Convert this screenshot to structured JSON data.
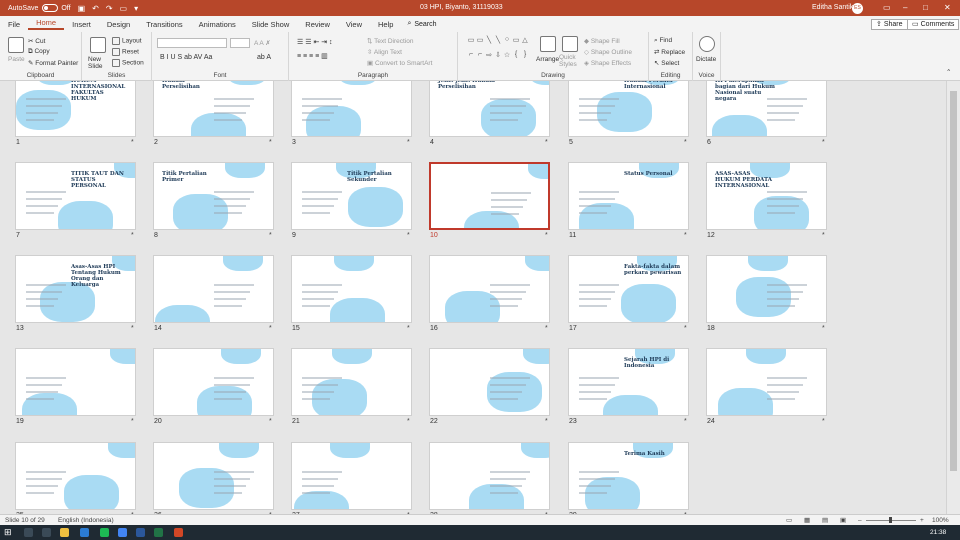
{
  "titlebar": {
    "autosave_label": "AutoSave",
    "autosave_state": "Off",
    "doc_title": "03 HPI, Biyanto, 31119033",
    "user_name": "Editha Santika",
    "user_initials": "ES"
  },
  "tabs": [
    "File",
    "Home",
    "Insert",
    "Design",
    "Transitions",
    "Animations",
    "Slide Show",
    "Review",
    "View",
    "Help"
  ],
  "search_label": "Search",
  "share_label": "Share",
  "comments_label": "Comments",
  "ribbon": {
    "clipboard": {
      "label": "Clipboard",
      "paste": "Paste",
      "cut": "Cut",
      "copy": "Copy",
      "format_painter": "Format Painter"
    },
    "slides": {
      "label": "Slides",
      "new_slide": "New Slide",
      "layout": "Layout",
      "reset": "Reset",
      "section": "Section"
    },
    "font": {
      "label": "Font"
    },
    "paragraph": {
      "label": "Paragraph",
      "text_direction": "Text Direction",
      "align_text": "Align Text",
      "convert": "Convert to SmartArt"
    },
    "drawing": {
      "label": "Drawing",
      "arrange": "Arrange",
      "quick_styles": "Quick Styles",
      "shape_fill": "Shape Fill",
      "shape_outline": "Shape Outline",
      "shape_effects": "Shape Effects"
    },
    "editing": {
      "label": "Editing",
      "find": "Find",
      "replace": "Replace",
      "select": "Select"
    },
    "voice": {
      "label": "Voice",
      "dictate": "Dictate"
    }
  },
  "slides": [
    {
      "n": "1",
      "title": "HUKUM INTERNASIONAL FAKULTAS HUKUM",
      "selected": false
    },
    {
      "n": "2",
      "title": "Hukum Perselisihan",
      "selected": false
    },
    {
      "n": "3",
      "title": "",
      "selected": false
    },
    {
      "n": "4",
      "title": "Jenis-jenis Hukum Perselisihan",
      "selected": false
    },
    {
      "n": "5",
      "title": "Hukum Perdata Internasional",
      "selected": false
    },
    {
      "n": "6",
      "title": "HPI merupakan bagian dari Hukum Nasional suatu negara",
      "selected": false
    },
    {
      "n": "7",
      "title": "TITIK TAUT DAN STATUS PERSONAL",
      "selected": false
    },
    {
      "n": "8",
      "title": "Titik Pertalian Primer",
      "selected": false
    },
    {
      "n": "9",
      "title": "Titik Pertalian Sekunder",
      "selected": false
    },
    {
      "n": "10",
      "title": "",
      "selected": true
    },
    {
      "n": "11",
      "title": "Status Personal",
      "selected": false
    },
    {
      "n": "12",
      "title": "ASAS-ASAS HUKUM PERDATA INTERNASIONAL",
      "selected": false
    },
    {
      "n": "13",
      "title": "Asas-Asas HPI Tentang Hukum Orang dan Keluarga",
      "selected": false
    },
    {
      "n": "14",
      "title": "",
      "selected": false
    },
    {
      "n": "15",
      "title": "",
      "selected": false
    },
    {
      "n": "16",
      "title": "",
      "selected": false
    },
    {
      "n": "17",
      "title": "Fakta-fakta dalam perkara pewarisan",
      "selected": false
    },
    {
      "n": "18",
      "title": "",
      "selected": false
    },
    {
      "n": "19",
      "title": "",
      "selected": false
    },
    {
      "n": "20",
      "title": "",
      "selected": false
    },
    {
      "n": "21",
      "title": "",
      "selected": false
    },
    {
      "n": "22",
      "title": "",
      "selected": false
    },
    {
      "n": "23",
      "title": "Sejarah HPI di Indonesia",
      "selected": false
    },
    {
      "n": "24",
      "title": "",
      "selected": false
    },
    {
      "n": "25",
      "title": "",
      "selected": false
    },
    {
      "n": "26",
      "title": "",
      "selected": false
    },
    {
      "n": "27",
      "title": "",
      "selected": false
    },
    {
      "n": "28",
      "title": "",
      "selected": false
    },
    {
      "n": "29",
      "title": "Terima Kasih",
      "selected": false
    }
  ],
  "status": {
    "slide_info": "Slide 10 of 29",
    "language": "English (Indonesia)",
    "zoom": "100%"
  },
  "taskbar": {
    "time": "21:38"
  },
  "colors": {
    "accent": "#b7472a",
    "selected_border": "#c0392b",
    "slide_blob": "#a9dbf3"
  }
}
